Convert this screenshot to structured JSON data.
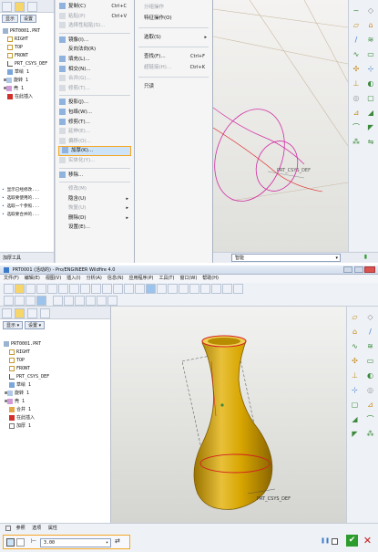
{
  "top": {
    "tree_tabs": [
      "显示",
      "设置"
    ],
    "tree_items": [
      "PRT0001.PRT",
      "RIGHT",
      "TOP",
      "FRONT",
      "PRT_CSYS_DEF",
      "草绘 1",
      "旋转 1",
      "壳 1",
      "在此插入"
    ],
    "tree_notes": [
      "显示已经修改...",
      "选取要使用的...",
      "选取一个参照...",
      "选取要合并的..."
    ],
    "status": "加厚工具",
    "menu1": {
      "items": [
        {
          "label": "复制(C)",
          "shortcut": "Ctrl+C",
          "icon": "copy-icon",
          "enabled": true
        },
        {
          "label": "粘贴(P)",
          "shortcut": "Ctrl+V",
          "icon": "paste-icon",
          "enabled": false
        },
        {
          "label": "选择性粘贴(S)...",
          "shortcut": "",
          "icon": "paste-special-icon",
          "enabled": false
        },
        {
          "label": "镜像(I)...",
          "shortcut": "",
          "icon": "mirror-icon",
          "enabled": true
        },
        {
          "label": "反向法向(R)",
          "shortcut": "",
          "icon": "",
          "enabled": true
        },
        {
          "label": "填充(L)...",
          "shortcut": "",
          "icon": "fill-icon",
          "enabled": true
        },
        {
          "label": "相交(N)...",
          "shortcut": "",
          "icon": "intersect-icon",
          "enabled": true
        },
        {
          "label": "合并(G)...",
          "shortcut": "",
          "icon": "merge-icon",
          "enabled": false
        },
        {
          "label": "修剪(T)...",
          "shortcut": "",
          "icon": "trim-icon",
          "enabled": false
        },
        {
          "label": "投影(J)...",
          "shortcut": "",
          "icon": "project-icon",
          "enabled": true
        },
        {
          "label": "包络(W)...",
          "shortcut": "",
          "icon": "wrap-icon",
          "enabled": true
        },
        {
          "label": "修剪(T)...",
          "shortcut": "",
          "icon": "trim2-icon",
          "enabled": true
        },
        {
          "label": "延伸(E)...",
          "shortcut": "",
          "icon": "extend-icon",
          "enabled": false
        },
        {
          "label": "偏移(O)...",
          "shortcut": "",
          "icon": "offset-icon",
          "enabled": false
        },
        {
          "label": "加厚(K)...",
          "shortcut": "",
          "icon": "thicken-icon",
          "enabled": true,
          "highlight": true
        },
        {
          "label": "实体化(Y)...",
          "shortcut": "",
          "icon": "solidify-icon",
          "enabled": false
        },
        {
          "label": "移除...",
          "shortcut": "",
          "icon": "remove-icon",
          "enabled": true
        },
        {
          "label": "修改(M)",
          "shortcut": "",
          "icon": "",
          "enabled": false
        },
        {
          "label": "隐含(U)",
          "shortcut": "",
          "icon": "",
          "enabled": true,
          "submenu": true
        },
        {
          "label": "恢复(U)",
          "shortcut": "",
          "icon": "",
          "enabled": false,
          "submenu": true
        },
        {
          "label": "删除(D)",
          "shortcut": "",
          "icon": "",
          "enabled": true,
          "submenu": true
        },
        {
          "label": "设置(E)...",
          "shortcut": "",
          "icon": "",
          "enabled": true
        }
      ]
    },
    "menu2": {
      "items": [
        {
          "label": "分组操作",
          "shortcut": "",
          "enabled": false
        },
        {
          "label": "特征操作(O)",
          "shortcut": "",
          "enabled": true
        },
        {
          "label": "选取(S)",
          "shortcut": "",
          "enabled": true,
          "submenu": true
        },
        {
          "label": "查找(F)...",
          "shortcut": "Ctrl+F",
          "enabled": true
        },
        {
          "label": "超链接(H)...",
          "shortcut": "Ctrl+K",
          "enabled": false
        },
        {
          "label": "只读",
          "shortcut": "",
          "enabled": true
        }
      ]
    },
    "viewport_label": "PRT_CSYS_DEF",
    "bottom_filter": "智能"
  },
  "bottom": {
    "title": "PRT0001 (活动的) - Pro/ENGINEER Wildfire 4.0",
    "menubar": [
      "文件(F)",
      "编辑(E)",
      "视图(V)",
      "插入(I)",
      "分析(A)",
      "信息(N)",
      "应用程序(P)",
      "工具(T)",
      "窗口(W)",
      "帮助(H)"
    ],
    "tree_tabs": [
      "显示",
      "设置"
    ],
    "tree_items": [
      "PRT0001.PRT",
      "RIGHT",
      "TOP",
      "FRONT",
      "PRT_CSYS_DEF",
      "草绘 1",
      "旋转 1",
      "壳 1",
      "合并 1",
      "在此插入",
      "加厚 1"
    ],
    "dashboard_tabs": [
      "参照",
      "选项",
      "属性"
    ],
    "thickness_value": "3.00",
    "viewport_label": "PRT_CSYS_DEF"
  },
  "colors": {
    "menu_bg": "#f5f5f5",
    "highlight_border": "#f5a623",
    "highlight_bg": "#cde3f7",
    "viewport_top": "#f3f3f1",
    "viewport_bottom": "#d9d9d5",
    "vase_fill": "#d6a600",
    "title_bar": "#dfe7f2",
    "ok_green": "#2c9c2c",
    "cancel_red": "#c91c1c"
  }
}
